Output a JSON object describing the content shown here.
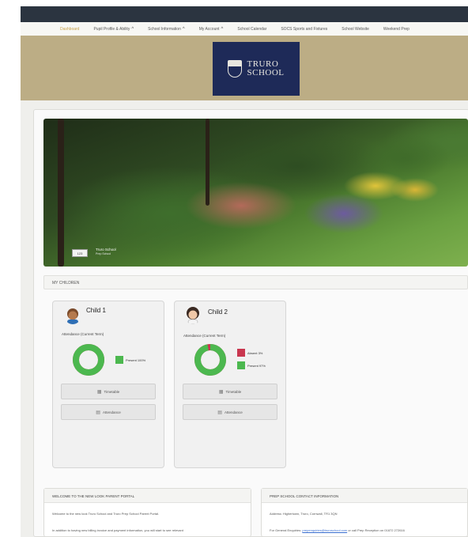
{
  "nav": {
    "items": [
      {
        "label": "Dashboard",
        "chevron": false,
        "active": true
      },
      {
        "label": "Pupil Profile & Ability",
        "chevron": true,
        "active": false
      },
      {
        "label": "School Information",
        "chevron": true,
        "active": false
      },
      {
        "label": "My Account",
        "chevron": true,
        "active": false
      },
      {
        "label": "School Calendar",
        "chevron": false,
        "active": false
      },
      {
        "label": "SOCS Sports and Fixtures",
        "chevron": false,
        "active": false
      },
      {
        "label": "School Website",
        "chevron": false,
        "active": false
      },
      {
        "label": "Weekend Prep",
        "chevron": false,
        "active": false
      }
    ],
    "chevron_glyph": "^"
  },
  "logo": {
    "line1": "TRURO",
    "line2": "SCHOOL",
    "icon": "school-crest-icon",
    "bg": "#1e2a58"
  },
  "colors": {
    "accent": "#c9a24a",
    "brand_band": "#bcad85",
    "present": "#4cb84f",
    "absent": "#c9374f",
    "topbar": "#2b3440"
  },
  "hero": {
    "badge": "123",
    "name": "Truro School",
    "subtitle": "Prep School"
  },
  "my_children": {
    "title": "MY CHILDREN"
  },
  "children": [
    {
      "name": "Child 1",
      "avatar": "child-avatar-icon",
      "attendance_label": "Attendance (Current Term)",
      "legend": [
        {
          "label": "Present 100%",
          "color": "#4cb84f",
          "value": 100
        }
      ],
      "present_fraction": 1.0,
      "buttons": [
        {
          "label": "Timetable",
          "icon": "calendar-icon"
        },
        {
          "label": "Attendance",
          "icon": "grid-icon"
        }
      ]
    },
    {
      "name": "Child 2",
      "avatar": "child-avatar-icon",
      "attendance_label": "Attendance (Current Term)",
      "legend": [
        {
          "label": "Absent 3%",
          "color": "#c9374f",
          "value": 3
        },
        {
          "label": "Present 97%",
          "color": "#4cb84f",
          "value": 97
        }
      ],
      "present_fraction": 0.97,
      "buttons": [
        {
          "label": "Timetable",
          "icon": "calendar-icon"
        },
        {
          "label": "Attendance",
          "icon": "grid-icon"
        }
      ]
    }
  ],
  "welcome": {
    "title": "WELCOME TO THE NEW LOOK PARENT PORTAL",
    "line1": "Welcome to the new look Truro School and Truro Prep School Parent Portal.",
    "line2": "In addition to having new billing invoice and payment information, you will start to see relevant"
  },
  "contact": {
    "title": "PREP SCHOOL CONTACT INFORMATION",
    "line1": "Address: Highertown, Truro, Cornwall, TR1 3QN",
    "line2_prefix": "For General Enquiries:",
    "line2_link": "prepenquiries@truroschool.com",
    "line2_suffix": "or call Prep Reception on 01872 272616"
  }
}
